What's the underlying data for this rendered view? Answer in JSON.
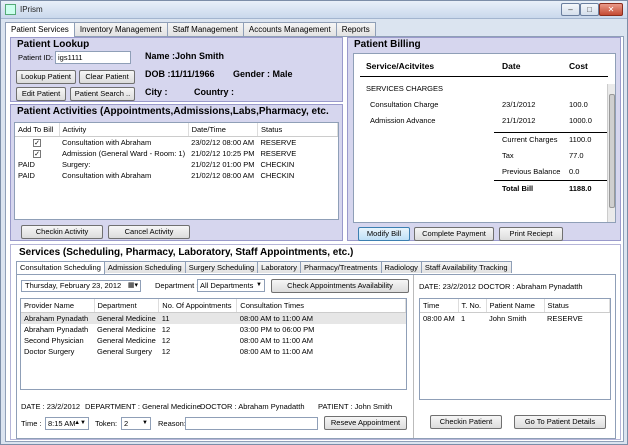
{
  "window": {
    "title": "IPrism",
    "controls": [
      "–",
      "□",
      "✕"
    ]
  },
  "main_tabs": [
    "Patient Services",
    "Inventory Management",
    "Staff Management",
    "Accounts Management",
    "Reports"
  ],
  "lookup": {
    "heading": "Patient Lookup",
    "patient_id_label": "Patient ID:",
    "patient_id_value": "igs1111",
    "name": "Name :John  Smith",
    "dob": "DOB :11/11/1966",
    "gender": "Gender : Male",
    "city": "City :",
    "country": "Country :",
    "buttons": {
      "lookup": "Lookup Patient",
      "clear": "Clear Patient",
      "edit": "Edit Patient",
      "search": "Patient Search .."
    }
  },
  "activities": {
    "heading": "Patient Activities (Appointments,Admissions,Labs,Pharmacy, etc.",
    "columns": [
      "Add To Bill",
      "Activity",
      "Date/Time",
      "Status"
    ],
    "rows": [
      {
        "bill": "✓",
        "activity": "Consultation with Abraham",
        "datetime": "23/02/12 08:00 AM",
        "status": "RESERVE"
      },
      {
        "bill": "✓",
        "activity": "Admission (General Ward - Room: 1)",
        "datetime": "21/02/12 10:25 PM",
        "status": "RESERVE"
      },
      {
        "bill": "PAID",
        "activity": "Surgery:",
        "datetime": "21/02/12 01:00 PM",
        "status": "CHECKIN"
      },
      {
        "bill": "PAID",
        "activity": "Consultation with Abraham",
        "datetime": "21/02/12 08:00 AM",
        "status": "CHECKIN"
      }
    ],
    "buttons": {
      "checkin": "Checkin Activity",
      "cancel": "Cancel Activity"
    }
  },
  "billing": {
    "heading": "Patient Billing",
    "columns": [
      "Service/Acitvites",
      "Date",
      "Cost"
    ],
    "section": "SERVICES CHARGES",
    "items": [
      {
        "name": "Consultation Charge",
        "date": "23/1/2012",
        "cost": "100.0"
      },
      {
        "name": "Admission Advance",
        "date": "21/1/2012",
        "cost": "1000.0"
      }
    ],
    "summary": [
      {
        "label": "Current Charges",
        "value": "1100.0"
      },
      {
        "label": "Tax",
        "value": "77.0"
      },
      {
        "label": "Previous Balance",
        "value": "0.0"
      }
    ],
    "total_label": "Total Bill",
    "total_value": "1188.0",
    "buttons": {
      "modify": "Modify Bill",
      "complete": "Complete Payment",
      "print": "Print Reciept"
    }
  },
  "services": {
    "heading": "Services  (Scheduling, Pharmacy, Laboratory, Staff Appointments, etc.)",
    "tabs": [
      "Consultation Scheduling",
      "Admission Scheduling",
      "Surgery Scheduling",
      "Laboratory",
      "Pharmacy/Treatments",
      "Radiology",
      "Staff Availability Tracking"
    ],
    "date_weekday": "Thursday",
    "date_rest": ",  February  23, 2012",
    "department_label": "Department :",
    "department_value": "All Departments",
    "check_button": "Check Appointments Availability",
    "columns": [
      "Provider Name",
      "Department",
      "No. Of Appointments",
      "Consultation Times"
    ],
    "rows": [
      {
        "provider": "Abraham Pynadath",
        "dept": "General Medicine",
        "count": "11",
        "times": "08:00 AM to 11:00 AM"
      },
      {
        "provider": "Abraham Pynadath",
        "dept": "General Medicine",
        "count": "12",
        "times": "03:00 PM to 06:00 PM"
      },
      {
        "provider": "Second  Physician",
        "dept": "General Medicine",
        "count": "12",
        "times": "08:00 AM to 11:00 AM"
      },
      {
        "provider": "Doctor Surgery",
        "dept": "General Surgery",
        "count": "12",
        "times": "08:00 AM to 11:00 AM"
      }
    ],
    "footer": {
      "date": "DATE : 23/2/2012",
      "dept": "DEPARTMENT : General Medicine",
      "doctor": "DOCTOR : Abraham Pynadatth",
      "patient": "PATIENT : John  Smith",
      "time_label": "Time :",
      "time_value": "8:15 AM",
      "token_label": "Token:",
      "token_value": "2",
      "reason_label": "Reason:",
      "reserve_button": "Reseve Appointment"
    },
    "right": {
      "header": "DATE: 23/2/2012   DOCTOR : Abraham Pynadatth",
      "columns": [
        "Time",
        "T. No.",
        "Patient Name",
        "Status"
      ],
      "rows": [
        {
          "time": "08:00 AM",
          "tno": "1",
          "name": "John  Smith",
          "status": "RESERVE"
        }
      ],
      "buttons": {
        "checkin": "Checkin Patient",
        "details": "Go To Patient Details"
      }
    }
  }
}
